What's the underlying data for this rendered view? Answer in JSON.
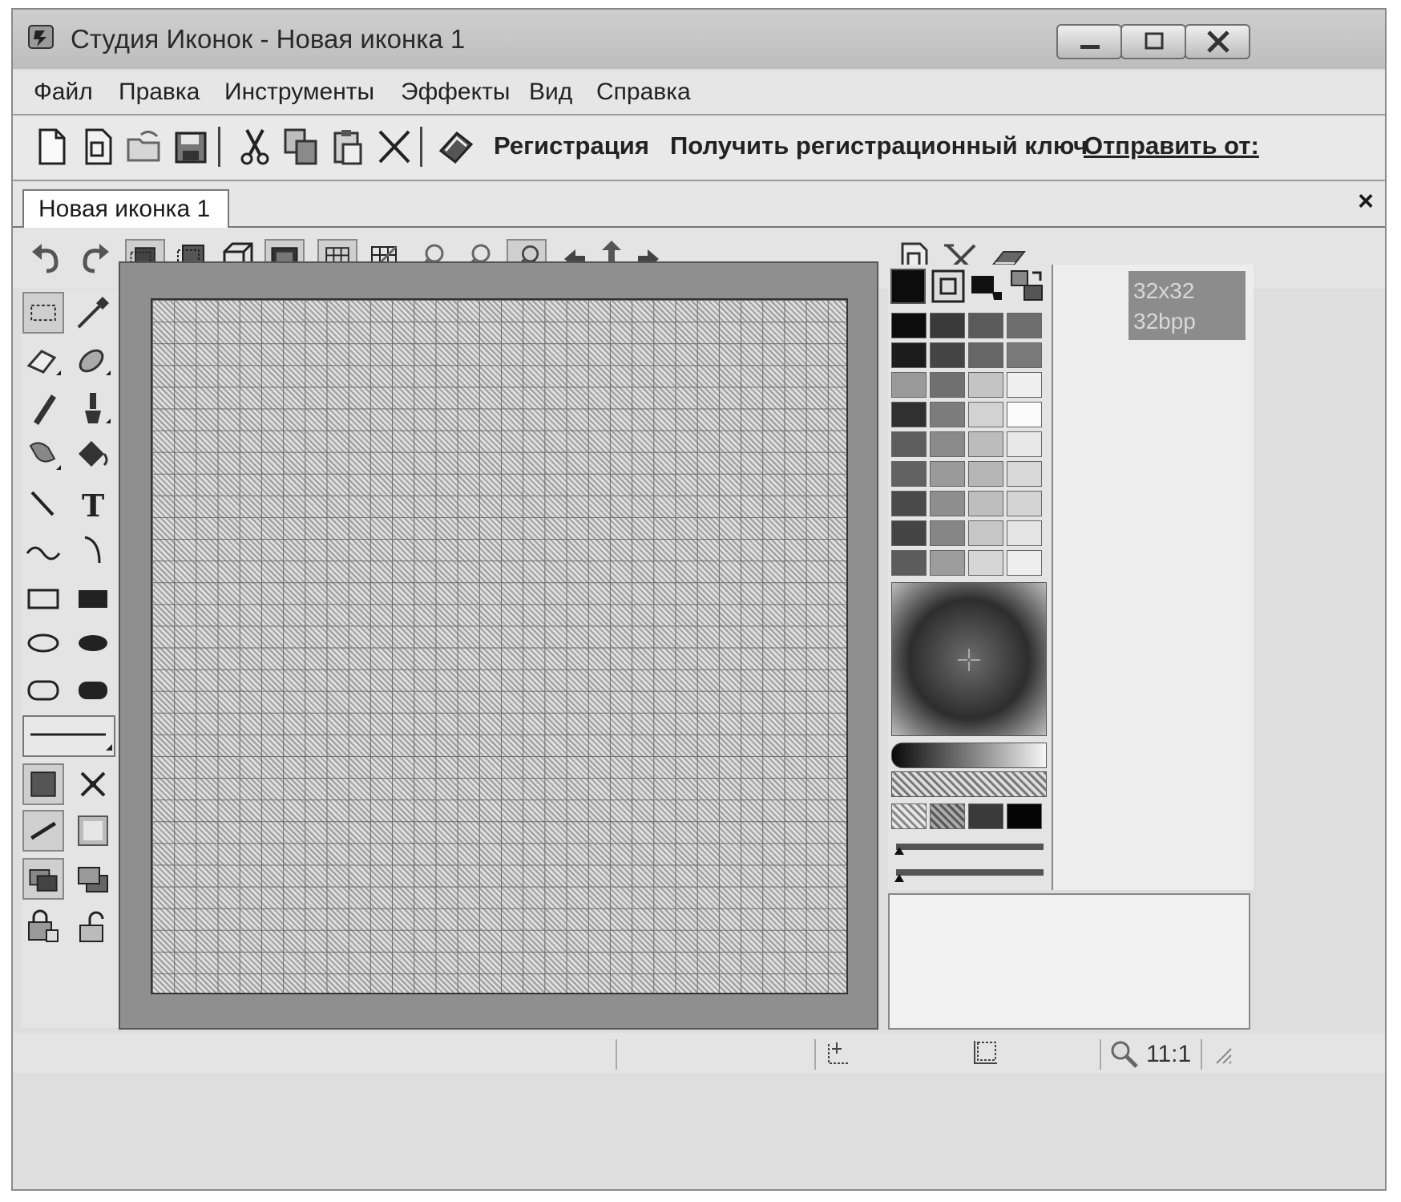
{
  "window": {
    "title": "Студия Иконок - Новая иконка 1",
    "controls": [
      "minimize",
      "maximize",
      "close"
    ]
  },
  "menu": [
    {
      "label": "Файл"
    },
    {
      "label": "Правка"
    },
    {
      "label": "Инструменты"
    },
    {
      "label": "Эффекты"
    },
    {
      "label": "Вид"
    },
    {
      "label": "Справка"
    }
  ],
  "toolbar": {
    "icons": [
      "new-file-icon",
      "new-document-icon",
      "open-folder-icon",
      "save-icon",
      "cut-icon",
      "copy-icon",
      "paste-icon",
      "delete-icon",
      "registration-book-icon"
    ],
    "register_label": "Регистрация",
    "get_key_label": "Получить регистрационный ключ",
    "send_label": "Отправить от:"
  },
  "document_tab": {
    "label": "Новая иконка 1",
    "close_glyph": "×"
  },
  "sizes_list": {
    "size": "32x32",
    "depth": "32bpp"
  },
  "status": {
    "zoom": "11:1"
  },
  "palette_colors": [
    "#0c0c0c",
    "#3a3a3a",
    "#5a5a5a",
    "#6e6e6e",
    "#1c1c1c",
    "#444444",
    "#666666",
    "#7a7a7a",
    "#9a9a9a",
    "#707070",
    "#c4c4c4",
    "#efefef",
    "#303030",
    "#7c7c7c",
    "#d2d2d2",
    "#fbfbfb",
    "#5e5e5e",
    "#8a8a8a",
    "#bcbcbc",
    "#e8e8e8",
    "#626262",
    "#9a9a9a",
    "#b6b6b6",
    "#d8d8d8",
    "#4a4a4a",
    "#8e8e8e",
    "#bebebe",
    "#d4d4d4",
    "#444444",
    "#868686",
    "#c6c6c6",
    "#e4e4e4",
    "#5c5c5c",
    "#9c9c9c",
    "#d6d6d6",
    "#eeeeee"
  ]
}
